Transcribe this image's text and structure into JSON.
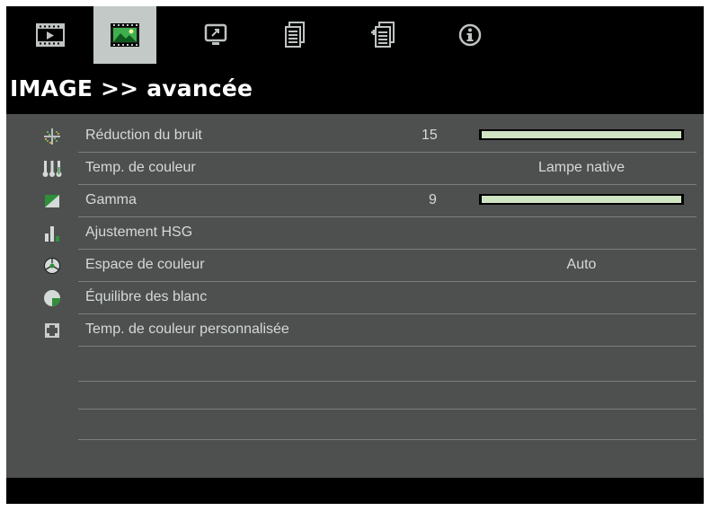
{
  "tabs": [
    {
      "icon": "film-play-icon",
      "active": false
    },
    {
      "icon": "image-icon",
      "active": true
    },
    {
      "icon": "display-icon",
      "active": false
    },
    {
      "icon": "document-settings-icon",
      "active": false
    },
    {
      "icon": "document-add-icon",
      "active": false
    },
    {
      "icon": "info-icon",
      "active": false
    }
  ],
  "title": "IMAGE >> avancée",
  "rows": [
    {
      "icon": "noise-reduction-icon",
      "label": "Réduction du bruit",
      "value": "15",
      "level": 1.0
    },
    {
      "icon": "color-temp-icon",
      "label": "Temp. de couleur",
      "value": "Lampe native"
    },
    {
      "icon": "gamma-icon",
      "label": "Gamma",
      "value": "9",
      "level": 1.0
    },
    {
      "icon": "hsg-icon",
      "label": "Ajustement HSG"
    },
    {
      "icon": "color-space-icon",
      "label": "Espace de couleur",
      "value": "Auto"
    },
    {
      "icon": "white-balance-icon",
      "label": "Équilibre des blanc"
    },
    {
      "icon": "custom-color-temp-icon",
      "label": "Temp. de couleur personnalisée"
    }
  ],
  "colors": {
    "osd_background": "#000000",
    "panel": "#4e5050",
    "active_tab": "#c3c9c6",
    "text": "#d4dad7",
    "slider_fill": "#cfe4c2",
    "icon_green": "#2f8f3a"
  }
}
